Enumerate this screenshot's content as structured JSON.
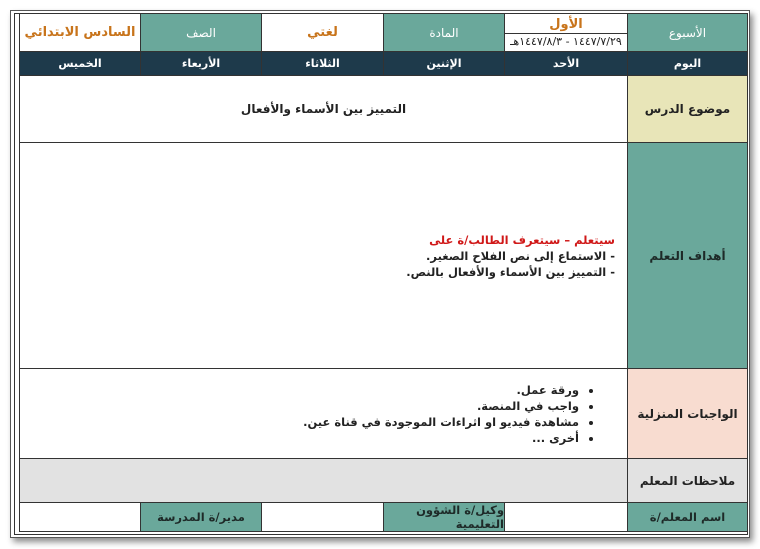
{
  "header": {
    "week_label": "الأسبوع",
    "week_value": "الأول",
    "week_dates": "١٤٤٧/٧/٢٩ - ١٤٤٧/٨/٣هـ",
    "subject_label": "المادة",
    "subject_value": "لغتي",
    "grade_label": "الصف",
    "grade_value": "السادس الابتدائي"
  },
  "days": {
    "label": "اليوم",
    "items": [
      "الأحد",
      "الإثنين",
      "الثلاثاء",
      "الأربعاء",
      "الخميس"
    ]
  },
  "lesson": {
    "label": "موضوع الدرس",
    "value": "التمييز بين الأسماء والأفعال"
  },
  "objectives": {
    "label": "أهداف التعلم",
    "intro": "سيتعلم – سيتعرف الطالب/ة على",
    "items": [
      "- الاستماع إلى نص الفلاح الصغير.",
      "- التمييز بين الأسماء والأفعال بالنص."
    ]
  },
  "homework": {
    "label": "الواجبات المنزلية",
    "items": [
      "ورقة عمل.",
      "واجب في المنصة.",
      "مشاهدة فيديو او اثراءات الموجودة في قناة عين.",
      "أخرى ..."
    ]
  },
  "notes": {
    "label": "ملاحظات المعلم"
  },
  "signatures": {
    "teacher_label": "اسم المعلم/ة",
    "deputy_label": "وكيل/ة الشؤون التعليمية",
    "principal_label": "مدير/ة المدرسة"
  },
  "colors": {
    "teal": "#6aa89b",
    "dark_blue": "#1e3a4b",
    "khaki": "#e8e5b8",
    "pink": "#f8dcd0",
    "orange": "#c8741b",
    "red": "#d01818"
  }
}
